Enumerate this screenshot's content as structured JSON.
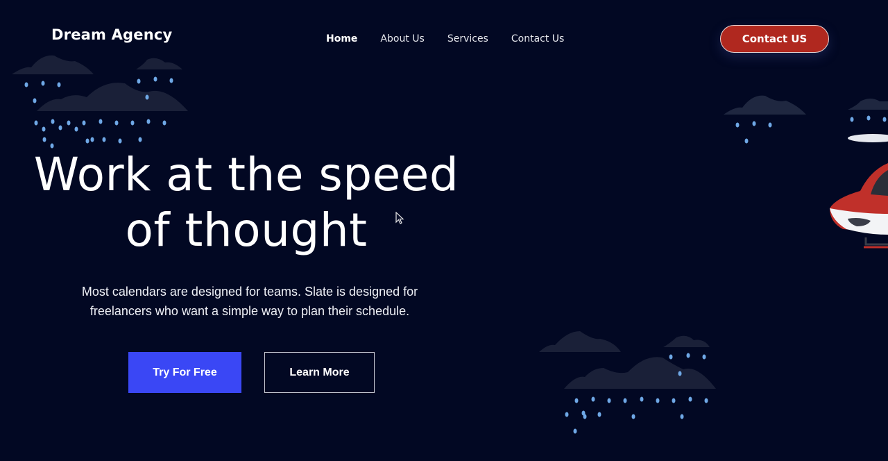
{
  "brand": {
    "name": "Dream Agency"
  },
  "nav": {
    "items": [
      {
        "label": "Home",
        "active": true
      },
      {
        "label": "About Us",
        "active": false
      },
      {
        "label": "Services",
        "active": false
      },
      {
        "label": "Contact Us",
        "active": false
      }
    ],
    "cta_label": "Contact US"
  },
  "hero": {
    "title_line1": "Work at the speed",
    "title_line2": "of thought",
    "subtitle_line1": "Most calendars are designed for teams. Slate is designed for",
    "subtitle_line2": "freelancers who want a simple way to plan their schedule.",
    "primary_button": "Try For Free",
    "secondary_button": "Learn More"
  },
  "colors": {
    "background": "#020823",
    "cta": "#b0281f",
    "primary": "#3a47f5",
    "cloud": "#1a2038",
    "rain": "#6fa8e6"
  },
  "icons": [
    "cloud-icon",
    "raindrop-icon",
    "helicopter-icon",
    "cursor-icon"
  ]
}
